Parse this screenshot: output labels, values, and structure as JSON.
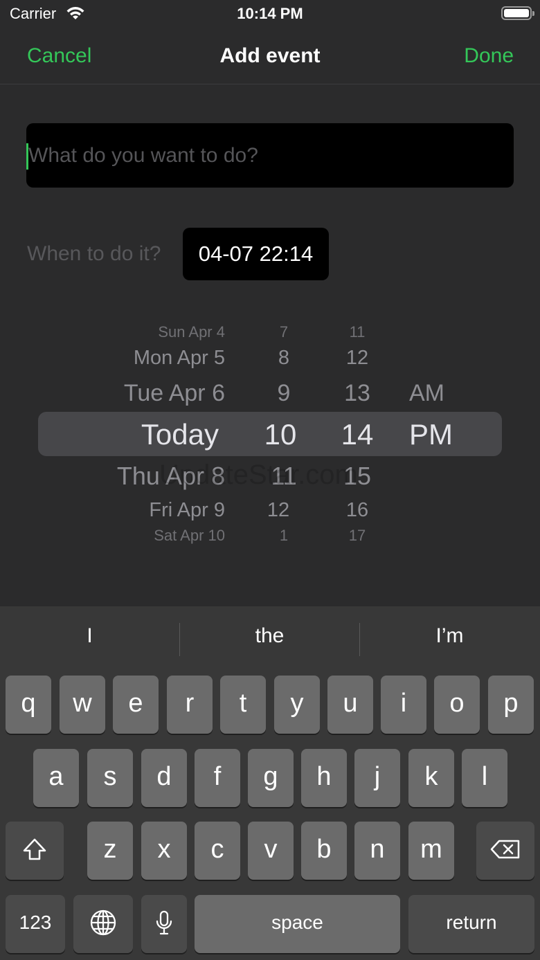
{
  "status_bar": {
    "carrier": "Carrier",
    "time": "10:14 PM"
  },
  "nav": {
    "cancel": "Cancel",
    "title": "Add event",
    "done": "Done"
  },
  "form": {
    "task_placeholder": "What do you want to do?",
    "task_value": "",
    "when_label": "When to do it?",
    "date_value": "04-07 22:14"
  },
  "picker": {
    "dates": [
      "Sun Apr 4",
      "Mon Apr 5",
      "Tue Apr 6",
      "Today",
      "Thu Apr 8",
      "Fri Apr 9",
      "Sat Apr 10"
    ],
    "hours": [
      "7",
      "8",
      "9",
      "10",
      "11",
      "12",
      "1"
    ],
    "minutes": [
      "11",
      "12",
      "13",
      "14",
      "15",
      "16",
      "17"
    ],
    "ampm": [
      "AM",
      "PM"
    ],
    "selected": {
      "date": "Today",
      "hour": "10",
      "minute": "14",
      "ampm": "PM"
    }
  },
  "watermark": "UpdateStar.com",
  "keyboard": {
    "suggestions": [
      "I",
      "the",
      "I’m"
    ],
    "row1": [
      "q",
      "w",
      "e",
      "r",
      "t",
      "y",
      "u",
      "i",
      "o",
      "p"
    ],
    "row2": [
      "a",
      "s",
      "d",
      "f",
      "g",
      "h",
      "j",
      "k",
      "l"
    ],
    "row3": [
      "z",
      "x",
      "c",
      "v",
      "b",
      "n",
      "m"
    ],
    "numbers_label": "123",
    "space_label": "space",
    "return_label": "return",
    "icons": {
      "shift": "shift-icon",
      "delete": "delete-icon",
      "globe": "globe-icon",
      "mic": "mic-icon"
    }
  },
  "colors": {
    "accent": "#34c759",
    "background": "#2b2b2c",
    "keyboard_bg": "#383838",
    "key": "#6b6b6b",
    "key_dark": "#4a4a4a"
  }
}
